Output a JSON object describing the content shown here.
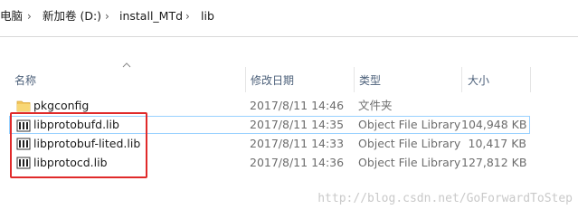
{
  "breadcrumb": {
    "items": [
      "电脑",
      "新加卷 (D:)",
      "install_MTd",
      "lib"
    ],
    "separator": "›"
  },
  "columns": {
    "name": "名称",
    "modified": "修改日期",
    "type": "类型",
    "size": "大小"
  },
  "files": [
    {
      "name": "pkgconfig",
      "modified": "2017/8/11 14:46",
      "type": "文件夹",
      "size": "",
      "icon": "folder-icon"
    },
    {
      "name": "libprotobufd.lib",
      "modified": "2017/8/11 14:35",
      "type": "Object File Library",
      "size": "104,948 KB",
      "icon": "lib-file-icon"
    },
    {
      "name": "libprotobuf-lited.lib",
      "modified": "2017/8/11 14:33",
      "type": "Object File Library",
      "size": "10,417 KB",
      "icon": "lib-file-icon"
    },
    {
      "name": "libprotocd.lib",
      "modified": "2017/8/11 14:36",
      "type": "Object File Library",
      "size": "127,812 KB",
      "icon": "lib-file-icon"
    }
  ],
  "watermark": "http://blog.csdn.net/GoForwardToStep",
  "colors": {
    "highlight": "#e02a2a",
    "selection": "#99d1ff",
    "header_text": "#4c607a",
    "folder": "#f2c55c"
  }
}
